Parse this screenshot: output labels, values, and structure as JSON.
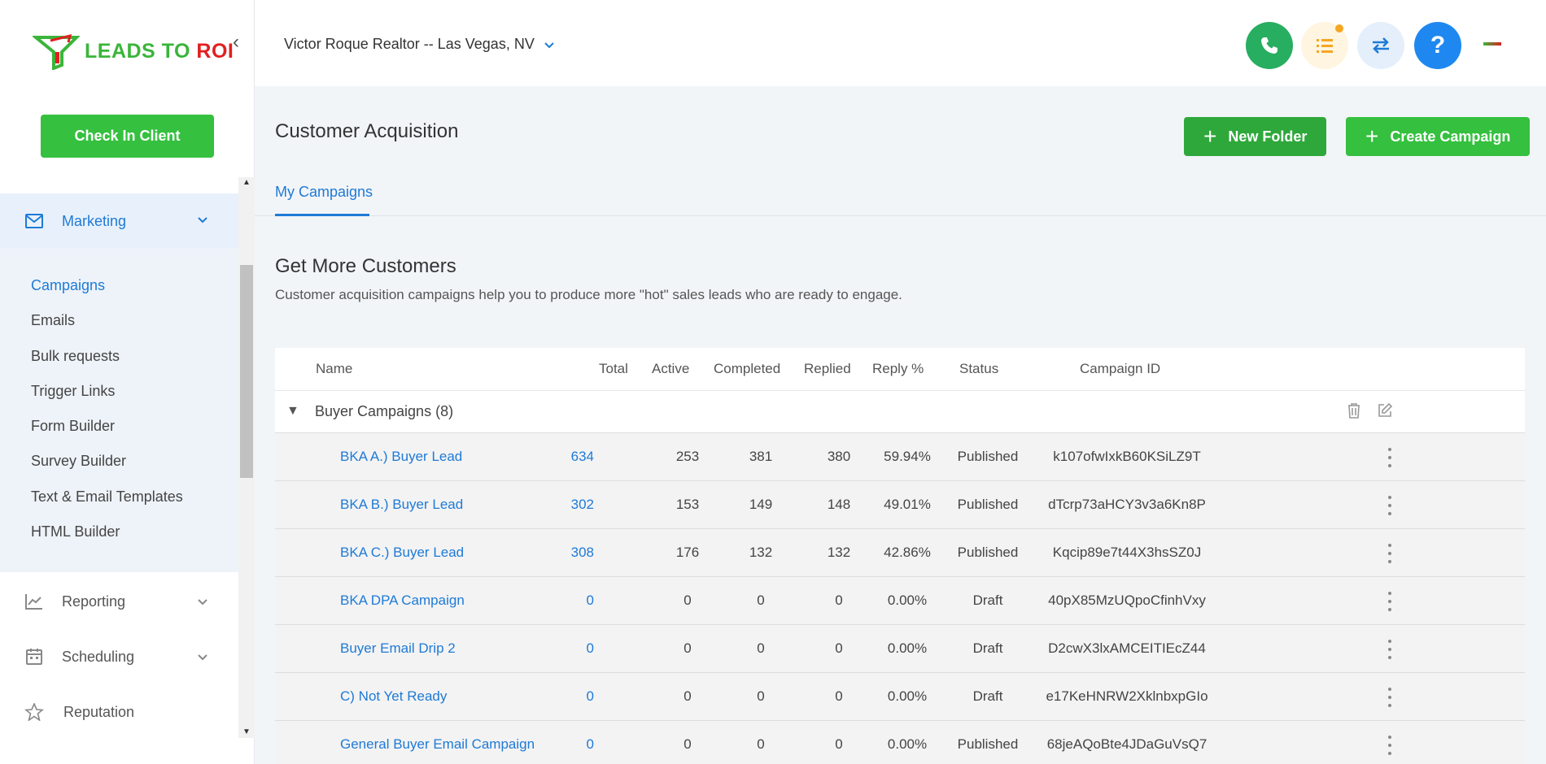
{
  "brand": {
    "logo_part1": "LEADS TO ",
    "logo_part2": "ROI"
  },
  "sidebar": {
    "checkin_label": "Check In Client",
    "marketing": {
      "label": "Marketing",
      "icon": "mail-icon"
    },
    "submenu": [
      {
        "label": "Campaigns",
        "active": true
      },
      {
        "label": "Emails"
      },
      {
        "label": "Bulk requests"
      },
      {
        "label": "Trigger Links"
      },
      {
        "label": "Form Builder"
      },
      {
        "label": "Survey Builder"
      },
      {
        "label": "Text & Email Templates"
      },
      {
        "label": "HTML Builder"
      }
    ],
    "items": [
      {
        "label": "Reporting",
        "icon": "chart-icon"
      },
      {
        "label": "Scheduling",
        "icon": "calendar-icon"
      },
      {
        "label": "Reputation",
        "icon": "star-icon"
      }
    ]
  },
  "header": {
    "account": "Victor Roque Realtor -- Las Vegas, NV",
    "colors": {
      "phone": "#27ae60",
      "tasks": "#fff5e0",
      "sync": "#e4effb",
      "help": "#1e88f0"
    }
  },
  "page": {
    "title": "Customer Acquisition",
    "new_folder_label": "New Folder",
    "create_campaign_label": "Create Campaign",
    "tab": "My Campaigns",
    "section_title": "Get More Customers",
    "section_desc": "Customer acquisition campaigns help you to produce more \"hot\" sales leads who are ready to engage."
  },
  "table": {
    "headers": {
      "name": "Name",
      "total": "Total",
      "active": "Active",
      "completed": "Completed",
      "replied": "Replied",
      "reply_pct": "Reply %",
      "status": "Status",
      "campaign_id": "Campaign ID"
    },
    "folder": "Buyer Campaigns (8)",
    "rows": [
      {
        "name": "BKA A.) Buyer Lead",
        "total": "634",
        "active": "253",
        "completed": "381",
        "replied": "380",
        "reply_pct": "59.94%",
        "status": "Published",
        "id": "k107ofwIxkB60KSiLZ9T"
      },
      {
        "name": "BKA B.) Buyer Lead",
        "total": "302",
        "active": "153",
        "completed": "149",
        "replied": "148",
        "reply_pct": "49.01%",
        "status": "Published",
        "id": "dTcrp73aHCY3v3a6Kn8P"
      },
      {
        "name": "BKA C.) Buyer Lead",
        "total": "308",
        "active": "176",
        "completed": "132",
        "replied": "132",
        "reply_pct": "42.86%",
        "status": "Published",
        "id": "Kqcip89e7t44X3hsSZ0J"
      },
      {
        "name": "BKA DPA Campaign",
        "total": "0",
        "active": "0",
        "completed": "0",
        "replied": "0",
        "reply_pct": "0.00%",
        "status": "Draft",
        "id": "40pX85MzUQpoCfinhVxy"
      },
      {
        "name": "Buyer Email Drip 2",
        "total": "0",
        "active": "0",
        "completed": "0",
        "replied": "0",
        "reply_pct": "0.00%",
        "status": "Draft",
        "id": "D2cwX3lxAMCEITIEcZ44"
      },
      {
        "name": "C) Not Yet Ready",
        "total": "0",
        "active": "0",
        "completed": "0",
        "replied": "0",
        "reply_pct": "0.00%",
        "status": "Draft",
        "id": "e17KeHNRW2XklnbxpGIo"
      },
      {
        "name": "General Buyer Email Campaign",
        "total": "0",
        "active": "0",
        "completed": "0",
        "replied": "0",
        "reply_pct": "0.00%",
        "status": "Published",
        "id": "68jeAQoBte4JDaGuVsQ7"
      }
    ]
  }
}
